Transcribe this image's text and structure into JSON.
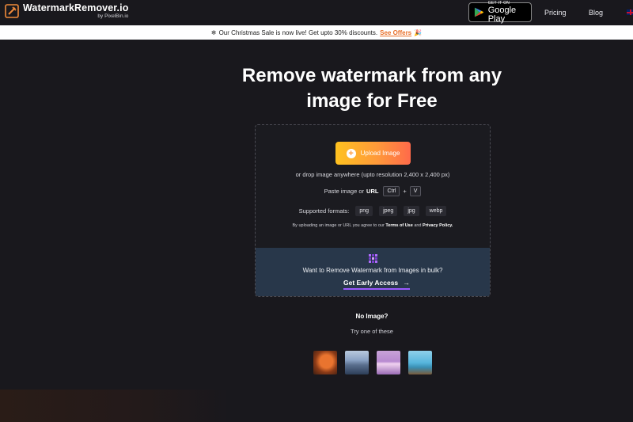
{
  "header": {
    "logo_title": "WatermarkRemover.io",
    "logo_sub": "by PixelBin.io",
    "google_play_small": "GET IT ON",
    "google_play_big": "Google Play",
    "nav": {
      "pricing": "Pricing",
      "blog": "Blog"
    }
  },
  "banner": {
    "message": "Our Christmas Sale is now live! Get upto 30% discounts.",
    "link": "See Offers"
  },
  "hero": {
    "title": "Remove watermark from any image for Free"
  },
  "upload": {
    "button_label": "Upload Image",
    "drop_text": "or drop image anywhere (upto resolution 2,400 x 2,400 px)",
    "paste_text": "Paste image or",
    "paste_url": "URL",
    "key_ctrl": "Ctrl",
    "key_plus": "+",
    "key_v": "V",
    "formats_label": "Supported formats:",
    "formats": [
      "png",
      "jpeg",
      "jpg",
      "webp"
    ],
    "terms_prefix": "By uploading an image or URL you agree to our",
    "terms_link": "Terms of Use",
    "terms_and": "and",
    "privacy_link": "Privacy Policy."
  },
  "bulk": {
    "question": "Want to Remove Watermark from Images in bulk?",
    "cta": "Get Early Access",
    "cta_arrow": "→"
  },
  "samples": {
    "title": "No Image?",
    "subtitle": "Try one of these"
  },
  "colors": {
    "background": "#19181d",
    "accent_orange": "#ff9a3a",
    "offers_link": "#e8702a",
    "bulk_panel": "#28374a",
    "cta_underline": "#9b59ff"
  }
}
